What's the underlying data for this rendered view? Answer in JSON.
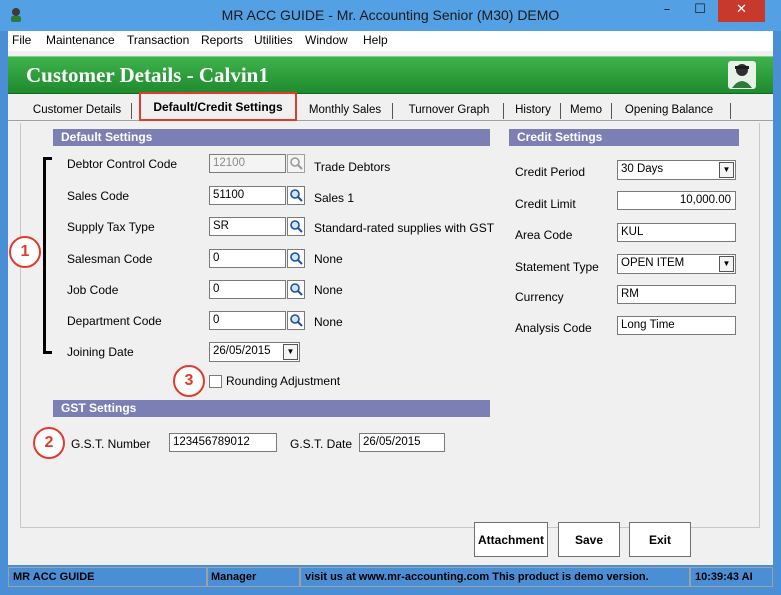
{
  "window": {
    "title": "MR ACC GUIDE - Mr. Accounting Senior (M30) DEMO",
    "min_glyph": "–",
    "max_glyph": "☐",
    "close_glyph": "✕"
  },
  "menu": [
    "File",
    "Maintenance",
    "Transaction",
    "Reports",
    "Utilities",
    "Window",
    "Help"
  ],
  "header": {
    "title": "Customer Details  -  Calvin1"
  },
  "tabs": [
    {
      "label": "Customer Details"
    },
    {
      "label": "Default/Credit Settings"
    },
    {
      "label": "Monthly Sales"
    },
    {
      "label": "Turnover Graph"
    },
    {
      "label": "History"
    },
    {
      "label": "Memo"
    },
    {
      "label": "Opening Balance"
    }
  ],
  "default_settings": {
    "heading": "Default Settings",
    "debtor_control_code": {
      "label": "Debtor Control Code",
      "value": "12100",
      "description": "Trade Debtors"
    },
    "sales_code": {
      "label": "Sales Code",
      "value": "51100",
      "description": "Sales 1"
    },
    "supply_tax_type": {
      "label": "Supply Tax Type",
      "value": "SR",
      "description": "Standard-rated supplies with GST"
    },
    "salesman_code": {
      "label": "Salesman Code",
      "value": "0",
      "description": "None"
    },
    "job_code": {
      "label": "Job Code",
      "value": "0",
      "description": "None"
    },
    "department_code": {
      "label": "Department Code",
      "value": "0",
      "description": "None"
    },
    "joining_date": {
      "label": "Joining Date",
      "value": "26/05/2015"
    },
    "rounding_adjustment": {
      "label": "Rounding Adjustment",
      "checked": false
    }
  },
  "gst_settings": {
    "heading": "GST Settings",
    "gst_number": {
      "label": "G.S.T.  Number",
      "value": "123456789012"
    },
    "gst_date": {
      "label": "G.S.T. Date",
      "value": "26/05/2015"
    }
  },
  "credit_settings": {
    "heading": "Credit Settings",
    "credit_period": {
      "label": "Credit Period",
      "value": "30 Days"
    },
    "credit_limit": {
      "label": "Credit Limit",
      "value": "10,000.00"
    },
    "area_code": {
      "label": "Area Code",
      "value": "KUL"
    },
    "statement_type": {
      "label": "Statement Type",
      "value": "OPEN ITEM"
    },
    "currency": {
      "label": "Currency",
      "value": "RM"
    },
    "analysis_code": {
      "label": "Analysis Code",
      "value": "Long Time"
    }
  },
  "annotations": [
    "1",
    "2",
    "3"
  ],
  "buttons": {
    "attachment": "Attachment",
    "save": "Save",
    "exit": "Exit"
  },
  "status": {
    "app": "MR ACC GUIDE",
    "user": "Manager",
    "message": "visit us at www.mr-accounting.com This product is demo version.",
    "time": "10:39:43 AI"
  },
  "colors": {
    "accent_red": "#e03b2b",
    "section_head": "#7b7fb4",
    "header_green": "#1e8b2e",
    "titlebar_blue": "#54a0e4"
  }
}
